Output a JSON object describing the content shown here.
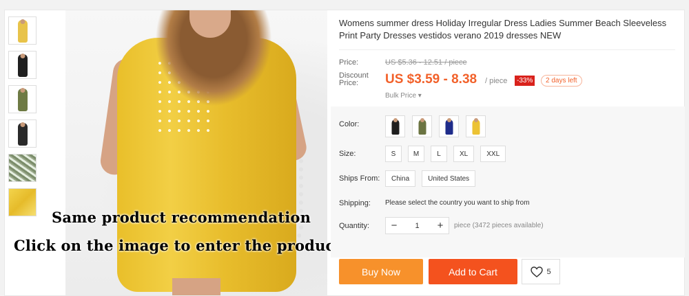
{
  "product": {
    "title": "Womens summer dress Holiday Irregular Dress Ladies Summer Beach Sleeveless Print Party Dresses vestidos verano 2019 dresses NEW"
  },
  "thumbnails": [
    {
      "icon": "yellow-dress-thumb",
      "color": "#e8c34a"
    },
    {
      "icon": "black-dress-thumb",
      "color": "#1f1f1f"
    },
    {
      "icon": "olive-dress-thumb",
      "color": "#6e7a44"
    },
    {
      "icon": "black-dress-thumb",
      "color": "#2a2a2a"
    },
    {
      "icon": "pattern-thumb",
      "color": "#7b8d6a"
    },
    {
      "icon": "yellow-fabric-thumb",
      "color": "#f3d44c"
    }
  ],
  "overlay": {
    "line1": "Same product recommendation",
    "line2": "Click on the image to enter the product link"
  },
  "price": {
    "label": "Price:",
    "original": "US $5.36 - 12.51 / piece",
    "discount_label": "Discount Price:",
    "current": "US $3.59 - 8.38",
    "unit": "/ piece",
    "percent_off": "-33%",
    "days_left": "2 days left",
    "bulk": "Bulk Price ▾"
  },
  "options": {
    "color_label": "Color:",
    "colors": [
      {
        "name": "black",
        "hex": "#1e1e1e"
      },
      {
        "name": "army-green",
        "hex": "#6b7442"
      },
      {
        "name": "navy-blue",
        "hex": "#1f2c8a"
      },
      {
        "name": "yellow",
        "hex": "#ecc233"
      }
    ],
    "size_label": "Size:",
    "sizes": [
      "S",
      "M",
      "L",
      "XL",
      "XXL"
    ],
    "ships_label": "Ships From:",
    "ships": [
      "China",
      "United States"
    ],
    "shipping_label": "Shipping:",
    "shipping_text": "Please select the country you want to ship from",
    "quantity_label": "Quantity:",
    "quantity_value": "1",
    "quantity_note": "piece (3472 pieces available)",
    "minus": "−",
    "plus": "+"
  },
  "actions": {
    "buy_now": "Buy Now",
    "add_to_cart": "Add to Cart",
    "wishlist_count": "5"
  },
  "colors": {
    "accent_orange": "#f4521e",
    "buy_orange": "#f7912b",
    "price_orange": "#f2612a",
    "discount_red": "#d9221c"
  }
}
